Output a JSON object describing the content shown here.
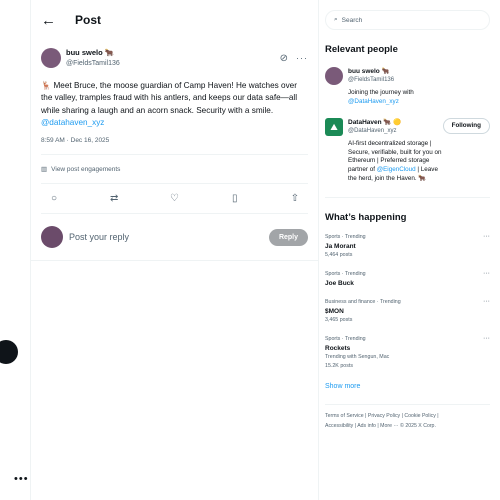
{
  "header": {
    "title": "Post",
    "back_icon": "←"
  },
  "tweet": {
    "author_name": "buu swelo 🐂",
    "author_handle": "@FieldsTamil136",
    "text": "🦌 Meet Bruce, the moose guardian of Camp Haven! He watches over the valley, tramples fraud with his antlers, and keeps our data safe—all while sharing a laugh and an acorn snack. Security with a smile.",
    "mention": "@datahaven_xyz",
    "meta": "8:59 AM · Dec 16, 2025",
    "engagements": "View post engagements"
  },
  "reply": {
    "placeholder": "Post your reply",
    "button": "Reply"
  },
  "search": {
    "placeholder": "Search"
  },
  "relevant": {
    "title": "Relevant people",
    "people": [
      {
        "name": "buu swelo 🐂",
        "handle": "@FieldsTamil136",
        "bio": "Joining the journey with",
        "bio_link": "@DataHaven_xyz"
      },
      {
        "name": "DataHaven 🐂 🟡",
        "handle": "@DataHaven_xyz",
        "follow": "Following",
        "bio": "AI-first decentralized storage | Secure, verifiable, built for you on Ethereum | Preferred storage partner of",
        "bio_link": "@EigenCloud",
        "bio_end": "| Leave the herd, join the Haven. 🐂"
      }
    ]
  },
  "happening": {
    "title": "What’s happening",
    "trends": [
      {
        "cat": "Sports · Trending",
        "name": "Ja Morant",
        "sub": "5,464 posts"
      },
      {
        "cat": "Sports · Trending",
        "name": "Joe Buck",
        "sub": ""
      },
      {
        "cat": "Business and finance · Trending",
        "name": "$MON",
        "sub": "3,465 posts"
      },
      {
        "cat": "Sports · Trending",
        "name": "Rockets",
        "sub": "Trending with Sengun, Mac",
        "sub2": "15.2K posts"
      }
    ],
    "show_more": "Show more"
  },
  "footer": {
    "line1": "Terms of Service | Privacy Policy | Cookie Policy |",
    "line2": "Accessibility | Ads info | More ··· © 2025 X Corp."
  }
}
